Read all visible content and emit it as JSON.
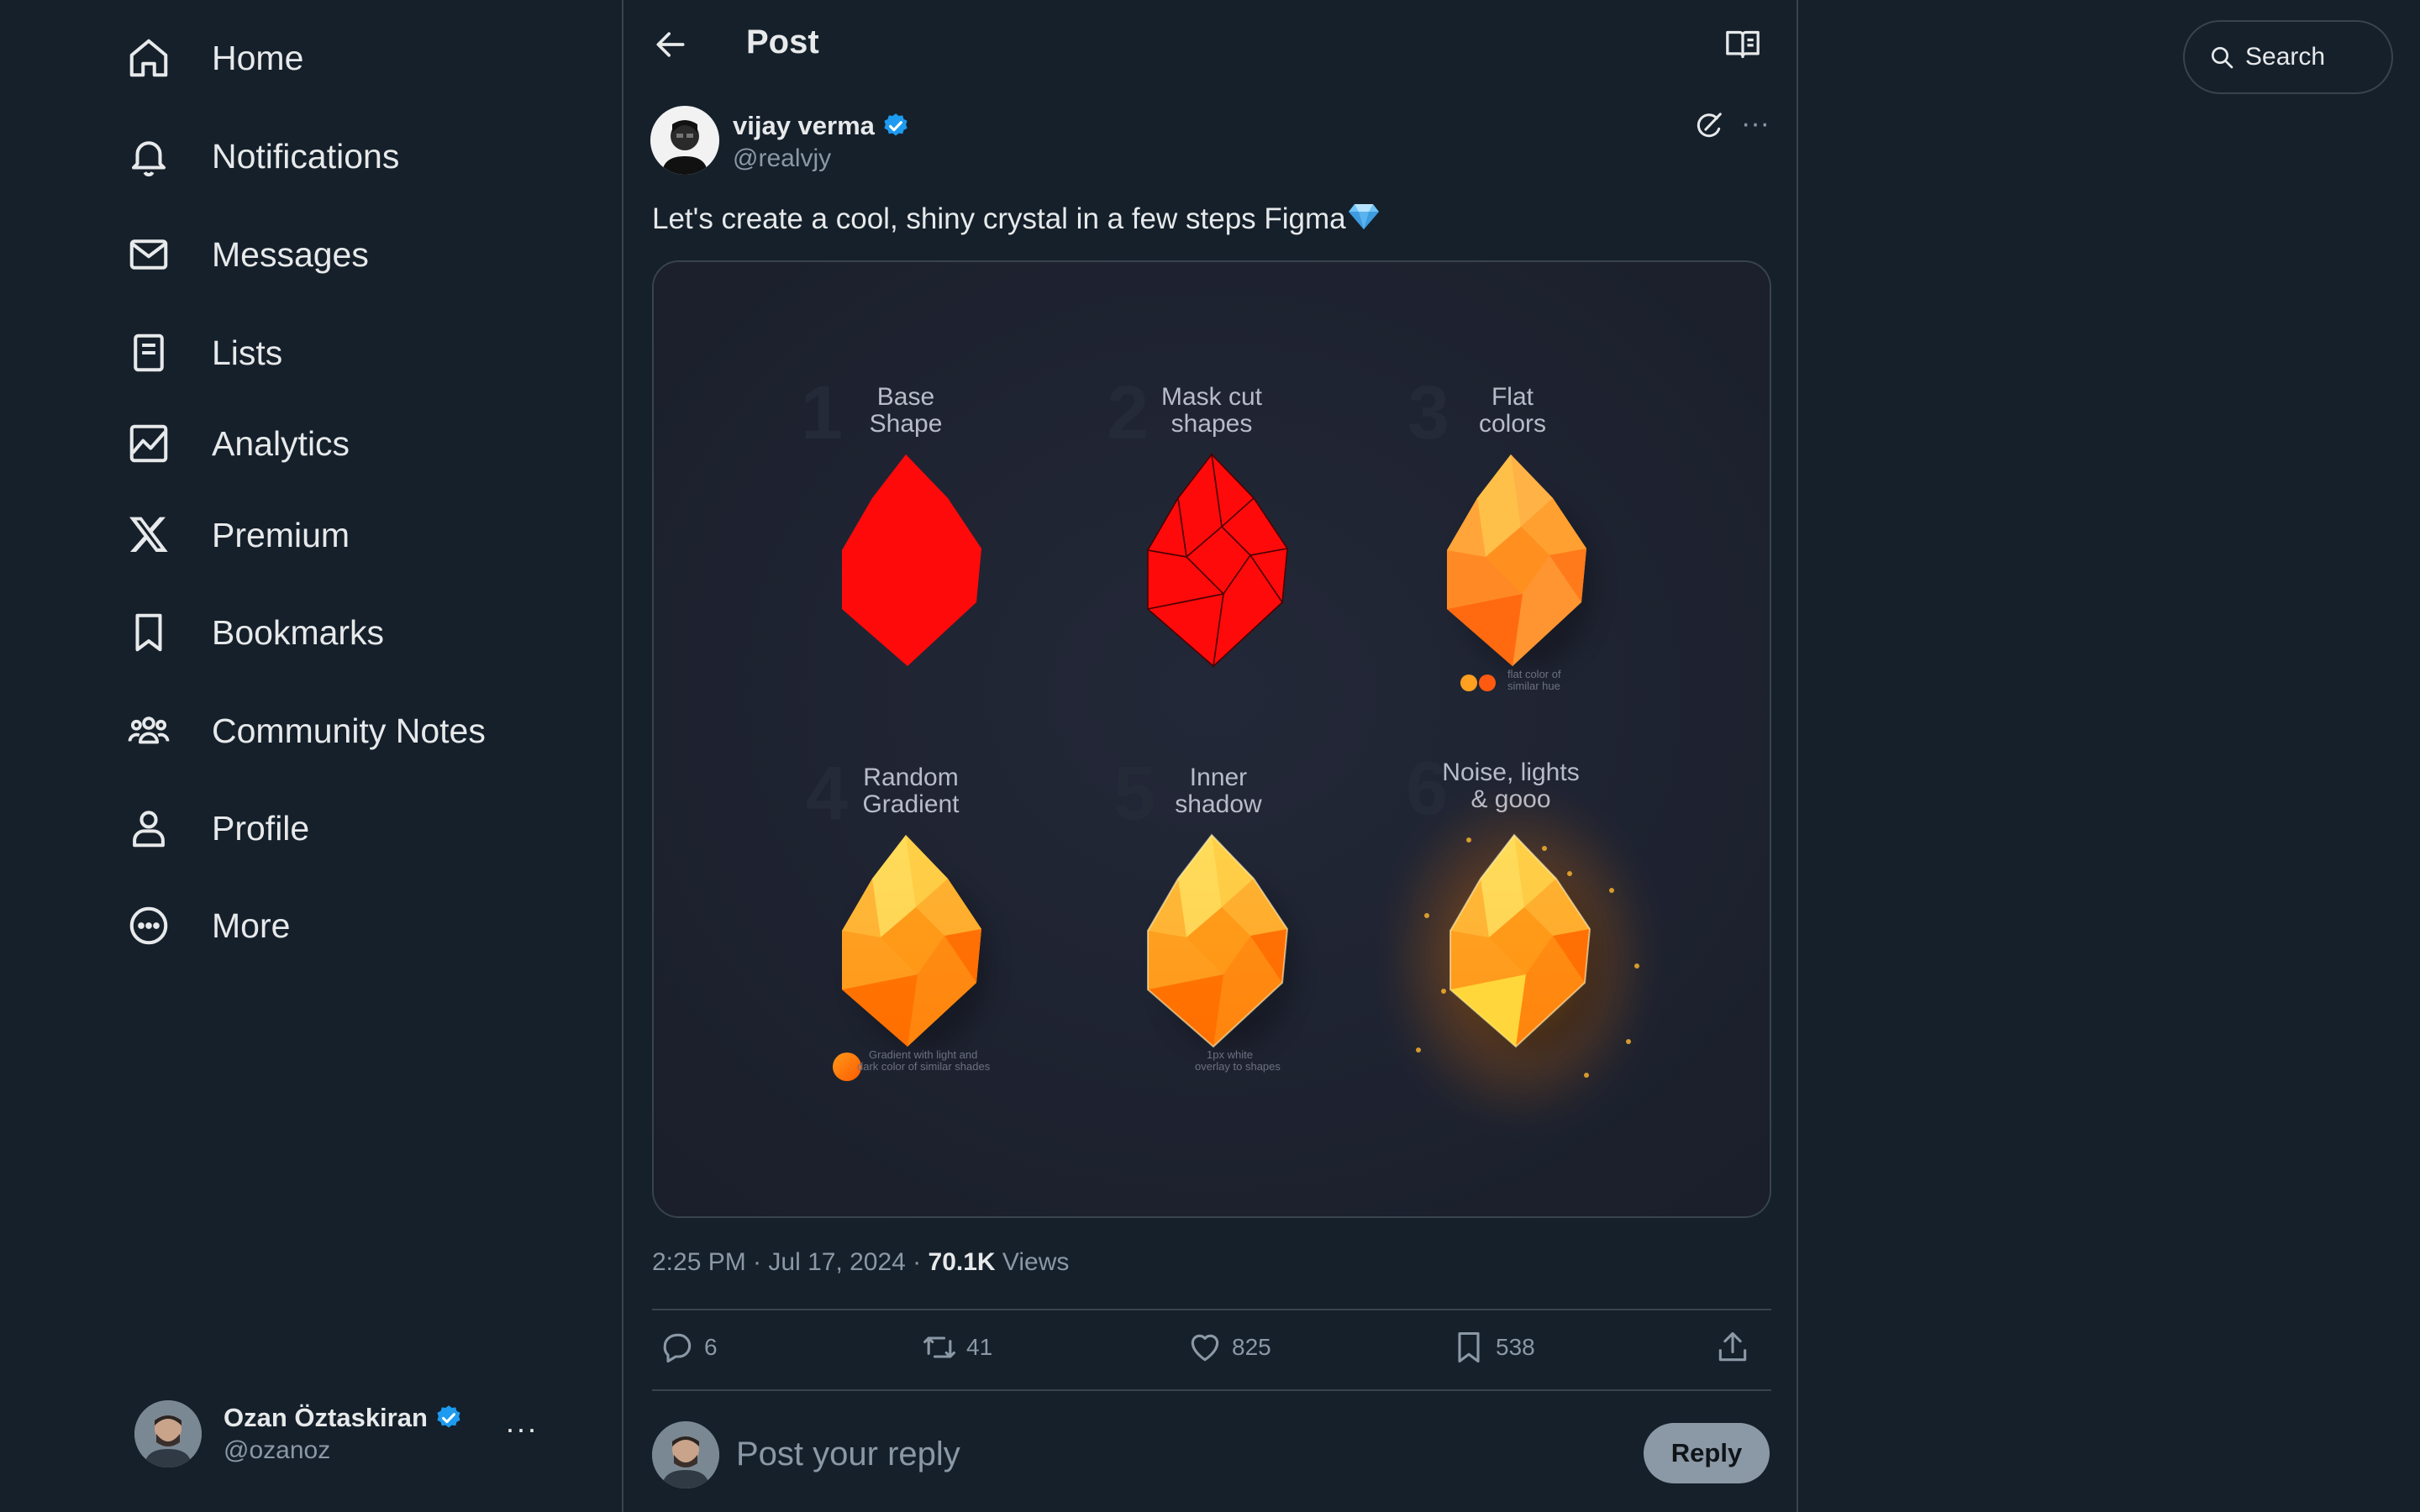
{
  "nav": {
    "items": [
      {
        "label": "Home",
        "icon": "home-icon"
      },
      {
        "label": "Notifications",
        "icon": "bell-icon"
      },
      {
        "label": "Messages",
        "icon": "envelope-icon"
      },
      {
        "label": "Lists",
        "icon": "list-icon"
      },
      {
        "label": "Analytics",
        "icon": "analytics-icon"
      },
      {
        "label": "Premium",
        "icon": "x-logo-icon"
      },
      {
        "label": "Bookmarks",
        "icon": "bookmark-icon"
      },
      {
        "label": "Community Notes",
        "icon": "community-icon"
      },
      {
        "label": "Profile",
        "icon": "person-icon"
      },
      {
        "label": "More",
        "icon": "more-circle-icon"
      }
    ]
  },
  "account": {
    "name": "Ozan Öztaskiran",
    "handle": "@ozanoz",
    "verified": true
  },
  "header": {
    "title": "Post"
  },
  "post": {
    "author_name": "vijay verma",
    "author_handle": "@realvjy",
    "verified": true,
    "text": "Let's create a cool, shiny crystal in a few steps Figma",
    "emoji": "gem-icon",
    "time": "2:25 PM · Jul 17, 2024 · ",
    "views_count": "70.1K",
    "views_label": " Views",
    "image": {
      "steps": [
        {
          "num": "1",
          "title_line1": "Base",
          "title_line2": "Shape"
        },
        {
          "num": "2",
          "title_line1": "Mask cut",
          "title_line2": "shapes"
        },
        {
          "num": "3",
          "title_line1": "Flat",
          "title_line2": "colors",
          "note_line1": "flat color of",
          "note_line2": "similar hue"
        },
        {
          "num": "4",
          "title_line1": "Random",
          "title_line2": "Gradient",
          "note_line1": "Gradient with light and",
          "note_line2": "dark color of similar shades"
        },
        {
          "num": "5",
          "title_line1": "Inner",
          "title_line2": "shadow",
          "note_line1": "1px white",
          "note_line2": "overlay to shapes"
        },
        {
          "num": "6",
          "title_line1": "Noise, lights",
          "title_line2": "& gooo"
        }
      ]
    }
  },
  "actions": {
    "replies": "6",
    "reposts": "41",
    "likes": "825",
    "bookmarks": "538"
  },
  "reply": {
    "placeholder": "Post your reply",
    "button": "Reply"
  },
  "search": {
    "label": "Search"
  },
  "colors": {
    "background": "#15202b",
    "border": "#38444d",
    "muted": "#8b98a5",
    "verified": "#1d9bf0"
  }
}
